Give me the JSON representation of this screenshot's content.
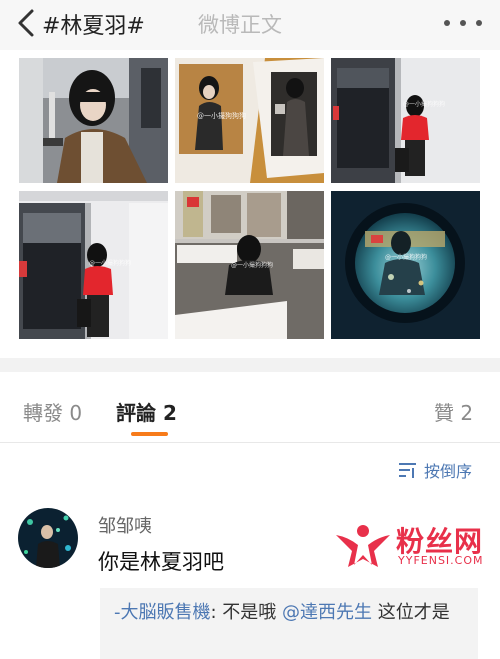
{
  "colors": {
    "accent": "#f77b1a",
    "link": "#4d78b3",
    "watermark": "#e8304a",
    "navbar_bg": "#f7f7f7"
  },
  "navbar": {
    "back_icon": "chevron-left-icon",
    "title": "#林夏羽#",
    "center_title": "微博正文",
    "more_icon": "more-icon"
  },
  "photos": {
    "watermark_text": "@一小撮狗狗狗"
  },
  "tabs": {
    "repost_label": "轉發",
    "repost_count": "0",
    "comment_label": "評論",
    "comment_count": "2",
    "like_label": "贊",
    "like_count": "2"
  },
  "sort": {
    "icon": "sort-descending-icon",
    "label": "按倒序"
  },
  "comment": {
    "username": "邹邹咦",
    "text": "你是林夏羽吧",
    "reply": {
      "user": "-大脳販售機",
      "separator": ": ",
      "text_before": "不是哦 ",
      "mention": "@達西先生",
      "text_after": " 这位才是"
    }
  },
  "watermark": {
    "main": "粉丝网",
    "sub": "YYFENSI.COM"
  }
}
